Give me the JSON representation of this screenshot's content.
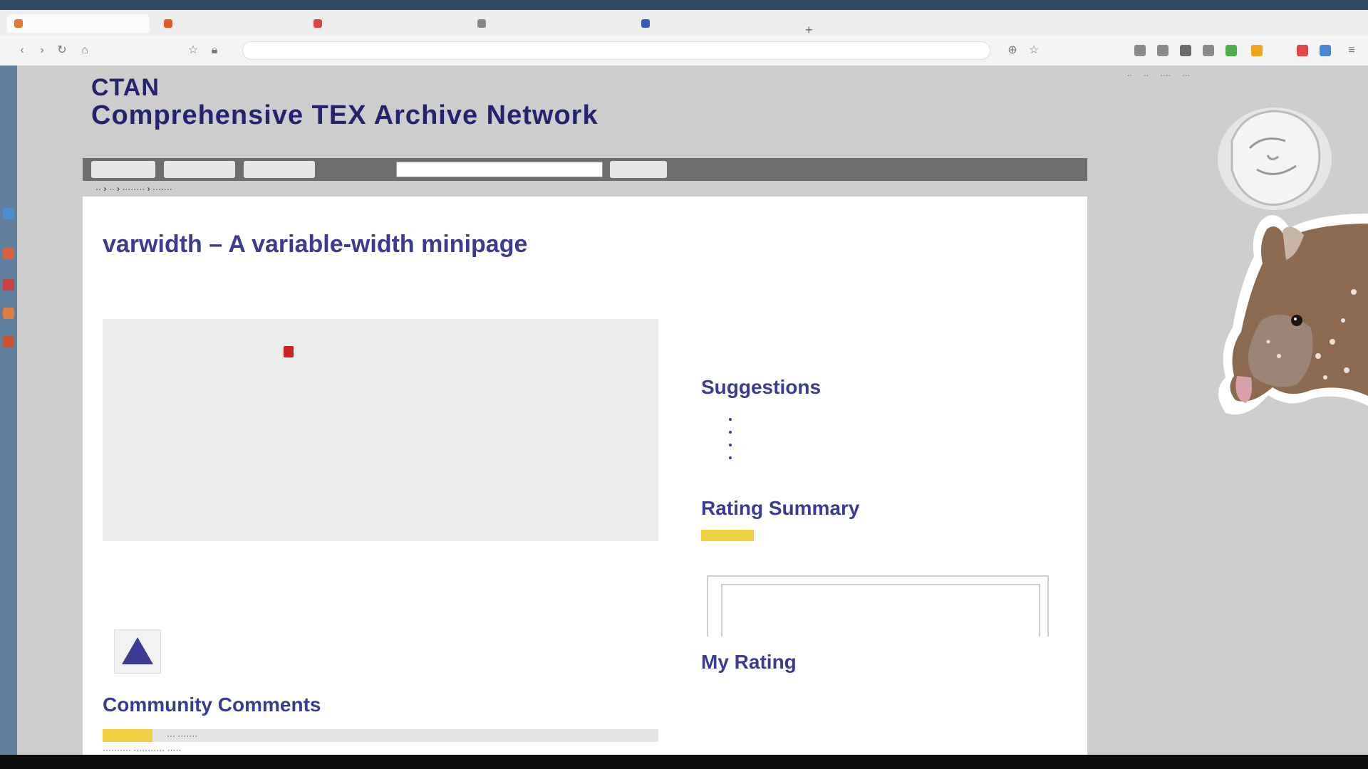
{
  "browser": {
    "tabs": [
      {
        "label": "",
        "color": "#e07a3a"
      },
      {
        "label": "",
        "color": "#e05a28"
      },
      {
        "label": "",
        "color": "#d44"
      },
      {
        "label": "",
        "color": "#888"
      },
      {
        "label": "",
        "color": "#3a5ab8"
      }
    ],
    "url": "",
    "extension_colors": [
      "#8a8a8a",
      "#8a8a8a",
      "#6a6a6a",
      "#8a8a8a",
      "#4cae4c",
      "#f2a41c",
      "#e04848",
      "#4a86d8"
    ]
  },
  "site": {
    "title_line1": "CTAN",
    "title_line2": "Comprehensive TEX Archive Network"
  },
  "nav": {
    "items": [
      "",
      "",
      ""
    ],
    "search_placeholder": "",
    "search_button": ""
  },
  "package": {
    "title": "varwidth – A variable-width minipage",
    "description": "",
    "info_keys": [
      "",
      "",
      "",
      "",
      "",
      "",
      "",
      "",
      ""
    ],
    "info_values": [
      "",
      "",
      "",
      "",
      "",
      "",
      "",
      "",
      ""
    ]
  },
  "announcement": {
    "link": "",
    "text": ""
  },
  "sections": {
    "community_comments": "Community Comments",
    "suggestions": "Suggestions",
    "rating_summary": "Rating Summary",
    "my_rating": "My Rating"
  },
  "suggestions": {
    "intro": "",
    "items": [
      "",
      "",
      "",
      ""
    ],
    "more": ""
  },
  "rating": {
    "stars_fraction": 0.8,
    "summary": ""
  },
  "my_rating": {
    "link": "",
    "text": ""
  },
  "colors": {
    "accent": "#3b3b92",
    "star": "#f0d040"
  }
}
